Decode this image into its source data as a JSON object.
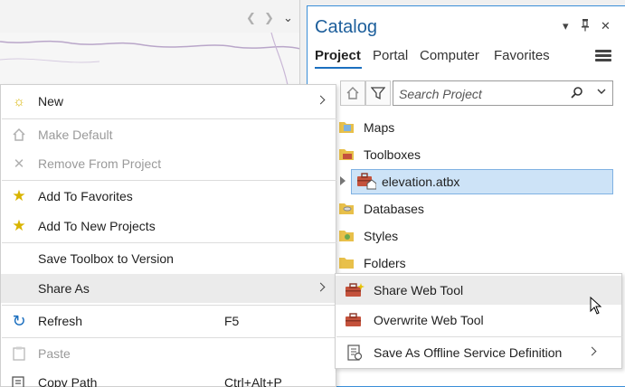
{
  "map": {
    "nav_prev_icon": "chevron-left-icon",
    "nav_next_icon": "chevron-right-icon",
    "nav_menu_icon": "chevron-down-icon"
  },
  "catalog": {
    "title": "Catalog",
    "controls": {
      "menu": "▾",
      "pin": "pin-icon",
      "close": "✕"
    },
    "tabs": [
      {
        "label": "Project",
        "active": true
      },
      {
        "label": "Portal",
        "active": false
      },
      {
        "label": "Computer",
        "active": false
      },
      {
        "label": "Favorites",
        "active": false
      }
    ],
    "search": {
      "placeholder": "Search Project",
      "value": ""
    },
    "tree": [
      {
        "label": "Maps",
        "icon": "maps-folder-icon"
      },
      {
        "label": "Toolboxes",
        "icon": "toolboxes-folder-icon"
      },
      {
        "label": "elevation.atbx",
        "icon": "toolbox-icon",
        "selected": true
      },
      {
        "label": "Databases",
        "icon": "databases-folder-icon"
      },
      {
        "label": "Styles",
        "icon": "styles-folder-icon"
      },
      {
        "label": "Folders",
        "icon": "folders-folder-icon"
      }
    ]
  },
  "context_menu": {
    "items": [
      {
        "label": "New",
        "icon": "new-sparkle-icon",
        "submenu": true
      },
      {
        "label": "Make Default",
        "icon": "make-default-icon",
        "disabled": true
      },
      {
        "label": "Remove From Project",
        "icon": "remove-icon",
        "disabled": true
      },
      {
        "label": "Add To Favorites",
        "icon": "star-icon"
      },
      {
        "label": "Add To New Projects",
        "icon": "star-pin-icon"
      },
      {
        "label": "Save Toolbox to Version",
        "icon": ""
      },
      {
        "label": "Share As",
        "icon": "",
        "submenu": true,
        "hover": true
      },
      {
        "label": "Refresh",
        "icon": "refresh-icon",
        "shortcut": "F5"
      },
      {
        "label": "Paste",
        "icon": "paste-icon",
        "disabled": true
      },
      {
        "label": "Copy Path",
        "icon": "copy-path-icon",
        "shortcut": "Ctrl+Alt+P"
      }
    ]
  },
  "share_submenu": {
    "items": [
      {
        "label": "Share Web Tool",
        "icon": "share-web-tool-icon",
        "hover": true
      },
      {
        "label": "Overwrite Web Tool",
        "icon": "overwrite-web-tool-icon"
      },
      {
        "label": "Save As Offline Service Definition",
        "icon": "service-definition-icon",
        "submenu": true
      }
    ]
  },
  "colors": {
    "accent": "#1c6fbf",
    "selection": "#cde3f7",
    "star": "#d9b400",
    "toolbox": "#c4523c"
  }
}
